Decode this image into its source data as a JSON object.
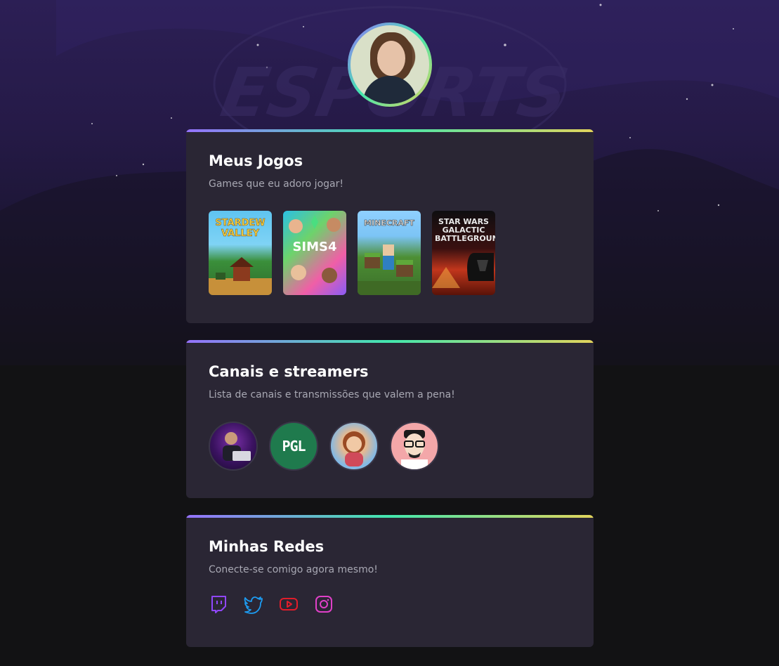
{
  "profile": {
    "avatar_name": "profile-photo"
  },
  "games_card": {
    "title": "Meus Jogos",
    "subtitle": "Games que eu adoro jogar!",
    "games": [
      {
        "title": "STARDEW VALLEY"
      },
      {
        "title": "SIMS4"
      },
      {
        "title": "MINECRAFT"
      },
      {
        "title": "STAR WARS GALACTIC BATTLEGROUNDS"
      }
    ]
  },
  "channels_card": {
    "title": "Canais e streamers",
    "subtitle": "Lista de canais e transmissões que valem a pena!",
    "channels": [
      {
        "label": ""
      },
      {
        "label": "PGL"
      },
      {
        "label": ""
      },
      {
        "label": ""
      }
    ]
  },
  "social_card": {
    "title": "Minhas Redes",
    "subtitle": "Conecte-se comigo agora mesmo!",
    "icons": [
      "twitch-icon",
      "twitter-icon",
      "youtube-icon",
      "instagram-icon"
    ]
  },
  "colors": {
    "accent_purple": "#9572fc",
    "accent_green": "#43e7ad",
    "accent_yellow": "#e2d45c",
    "twitch": "#9147ff",
    "twitter": "#1d9bf0",
    "youtube": "#e11d2a",
    "instagram": "#e040c8"
  }
}
